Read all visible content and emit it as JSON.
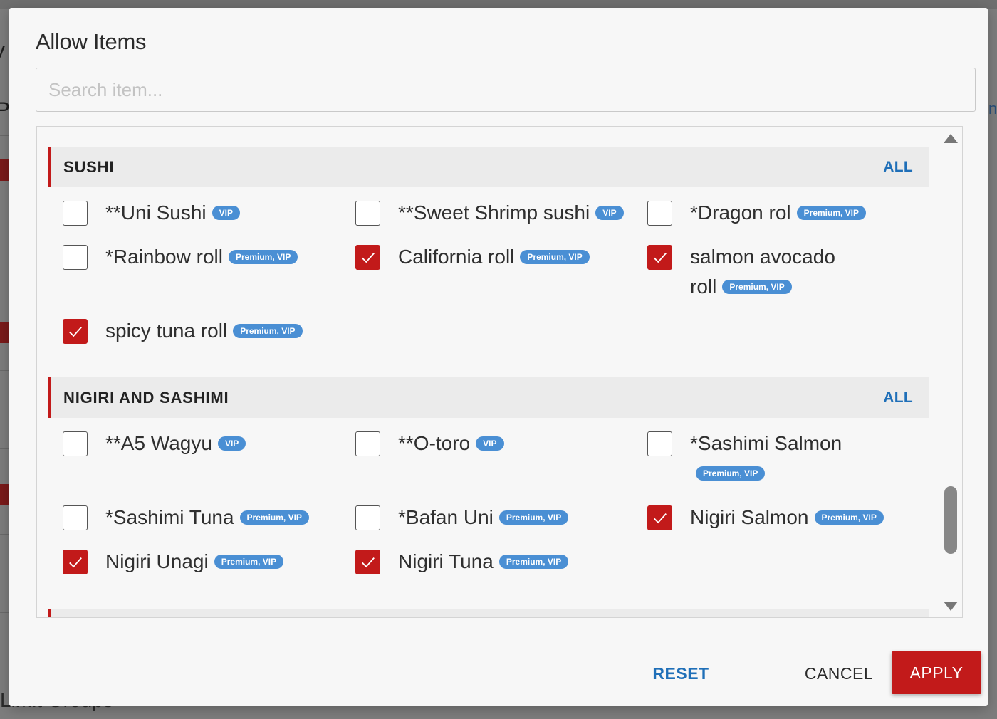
{
  "background": {
    "edge_text_1": "y",
    "edge_text_2": "P",
    "edge_text_right": "n",
    "bottom_text": "Limit Groups"
  },
  "modal": {
    "title": "Allow Items",
    "search": {
      "placeholder": "Search item...",
      "value": ""
    },
    "categories": [
      {
        "title": "SUSHI",
        "all_label": "ALL",
        "items": [
          {
            "label": "**Uni Sushi",
            "badge": "VIP",
            "checked": false
          },
          {
            "label": "**Sweet Shrimp sushi",
            "badge": "VIP",
            "checked": false
          },
          {
            "label": "*Dragon rol",
            "badge": "Premium, VIP",
            "checked": false
          },
          {
            "label": "*Rainbow roll",
            "badge": "Premium, VIP",
            "checked": false
          },
          {
            "label": "California roll",
            "badge": "Premium, VIP",
            "checked": true
          },
          {
            "label": "salmon avocado roll",
            "badge": "Premium, VIP",
            "checked": true
          },
          {
            "label": "spicy tuna roll",
            "badge": "Premium, VIP",
            "checked": true
          }
        ]
      },
      {
        "title": "NIGIRI AND SASHIMI",
        "all_label": "ALL",
        "items": [
          {
            "label": "**A5 Wagyu",
            "badge": "VIP",
            "checked": false
          },
          {
            "label": "**O-toro",
            "badge": "VIP",
            "checked": false
          },
          {
            "label": "*Sashimi Salmon",
            "badge": "Premium, VIP",
            "checked": false
          },
          {
            "label": "*Sashimi Tuna",
            "badge": "Premium, VIP",
            "checked": false
          },
          {
            "label": "*Bafan Uni",
            "badge": "Premium, VIP",
            "checked": false
          },
          {
            "label": "Nigiri Salmon",
            "badge": "Premium, VIP",
            "checked": true
          },
          {
            "label": "Nigiri Unagi",
            "badge": "Premium, VIP",
            "checked": true
          },
          {
            "label": "Nigiri Tuna",
            "badge": "Premium, VIP",
            "checked": true
          }
        ]
      }
    ],
    "buttons": {
      "reset": "RESET",
      "cancel": "CANCEL",
      "apply": "APPLY"
    }
  },
  "colors": {
    "accent_red": "#c21a1a",
    "link_blue": "#1f6fb8",
    "badge_blue": "#4a8fd4"
  }
}
